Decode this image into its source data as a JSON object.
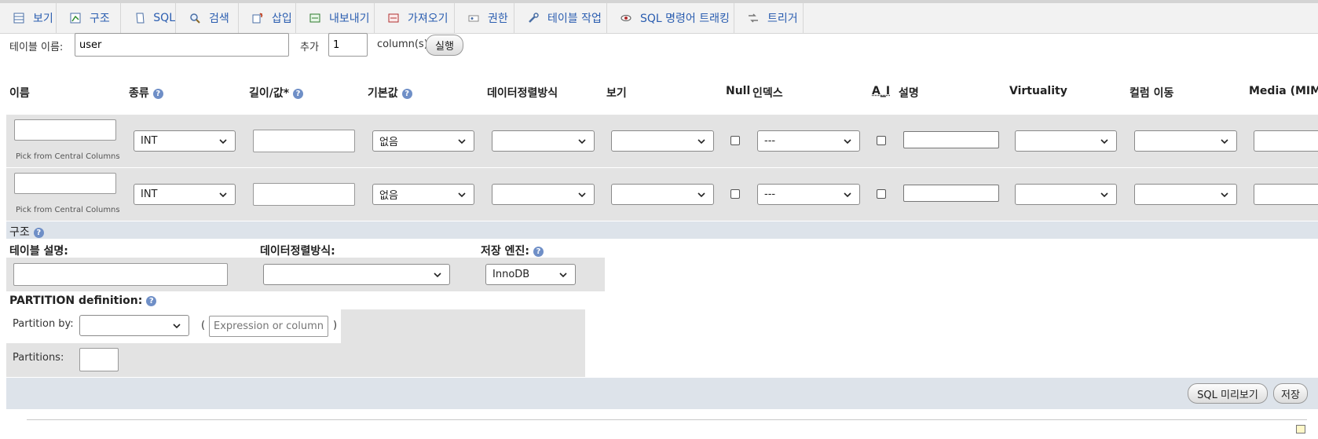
{
  "tabs": [
    {
      "label": "보기",
      "icon": "browse-icon"
    },
    {
      "label": "구조",
      "icon": "structure-icon"
    },
    {
      "label": "SQL",
      "icon": "sql-icon"
    },
    {
      "label": "검색",
      "icon": "search-icon"
    },
    {
      "label": "삽입",
      "icon": "insert-icon"
    },
    {
      "label": "내보내기",
      "icon": "export-icon"
    },
    {
      "label": "가져오기",
      "icon": "import-icon"
    },
    {
      "label": "권한",
      "icon": "privileges-icon"
    },
    {
      "label": "테이블 작업",
      "icon": "wrench-icon"
    },
    {
      "label": "SQL 명령어 트래킹",
      "icon": "eye-icon"
    },
    {
      "label": "트리거",
      "icon": "triggers-icon"
    }
  ],
  "table_name": {
    "label": "테이블 이름:",
    "value": "user"
  },
  "add": {
    "label": "추가",
    "value": "1",
    "suffix": "column(s)",
    "go": "실행"
  },
  "columns": {
    "name": "이름",
    "type": "종류",
    "length": "길이/값*",
    "default": "기본값",
    "collation": "데이터정렬방식",
    "attributes": "보기",
    "null": "Null",
    "index": "인덱스",
    "ai": "A_I",
    "comment": "설명",
    "virtuality": "Virtuality",
    "move": "컬럼 이동",
    "media": "Media (MIME)"
  },
  "rows": [
    {
      "type": "INT",
      "default": "없음",
      "index": "---",
      "central": "Pick from Central Columns"
    },
    {
      "type": "INT",
      "default": "없음",
      "index": "---",
      "central": "Pick from Central Columns"
    }
  ],
  "structure": {
    "title": "구조",
    "table_comment_label": "테이블 설명:",
    "collation_label": "데이터정렬방식:",
    "engine_label": "저장 엔진:",
    "engine_value": "InnoDB"
  },
  "partition": {
    "title": "PARTITION definition:",
    "by_label": "Partition by:",
    "expr_placeholder": "Expression or column list",
    "open_paren": "(",
    "close_paren": ")",
    "partitions_label": "Partitions:"
  },
  "footer": {
    "preview": "SQL 미리보기",
    "save": "저장"
  },
  "colors": {
    "link": "#2a5db0",
    "section": "#dde3ea",
    "row": "#e3e3e3"
  }
}
